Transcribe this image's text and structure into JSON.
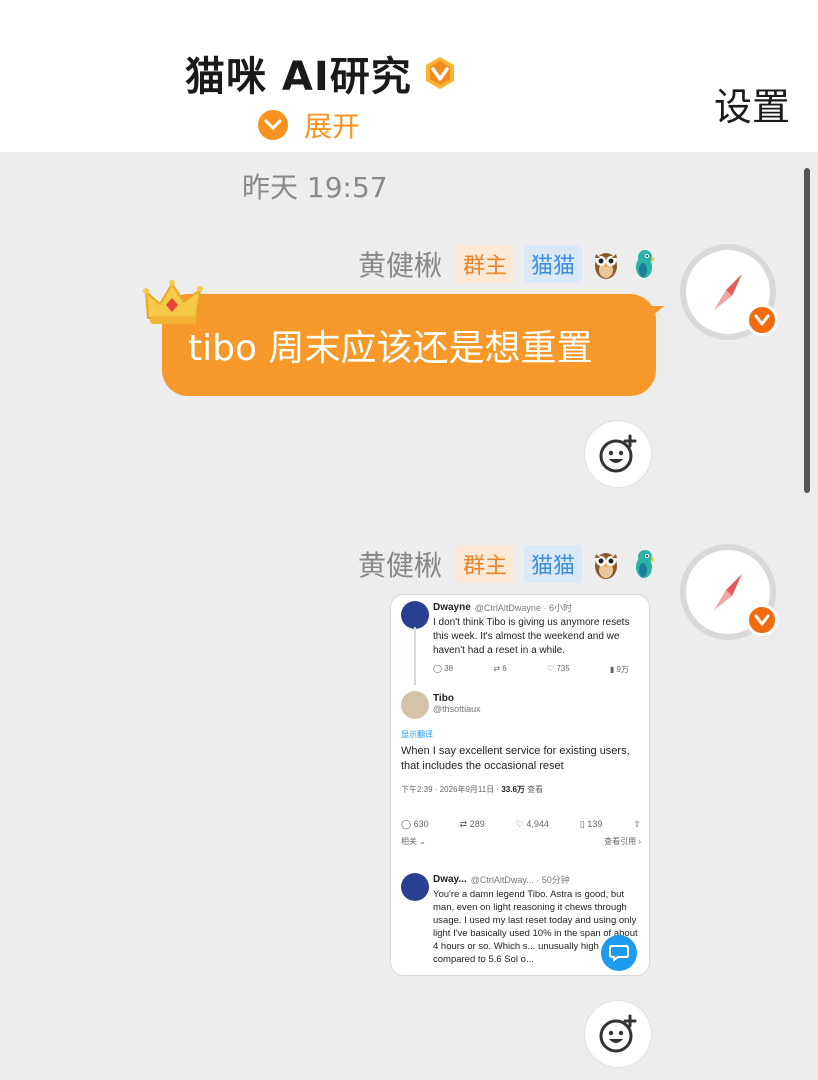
{
  "header": {
    "title": "猫咪 AI研究",
    "expand_label": "展开",
    "settings_label": "设置"
  },
  "chat": {
    "timestamp": "昨天 19:57",
    "messages": [
      {
        "sender": "黄健楸",
        "tags": [
          "群主",
          "猫猫"
        ],
        "text": "tibo 周末应该还是想重置"
      },
      {
        "sender": "黄健楸",
        "tags": [
          "群主",
          "猫猫"
        ],
        "image": {
          "tweets": [
            {
              "name": "Dwayne",
              "handle": "@CtrlAltDwayne · 6小时",
              "text": "I don't think Tibo is giving us anymore resets this week. It's almost the weekend and we haven't had a reset in a while.",
              "actions": [
                "38",
                "6",
                "735",
                "9万"
              ]
            },
            {
              "name": "Tibo",
              "handle": "@thsottiaux",
              "translate": "显示翻译",
              "text": "When I say excellent service for existing users, that includes the occasional reset",
              "meta": "下午2:39 · 2026年9月11日 · ",
              "views": "33.6万",
              "views_label": "查看",
              "actions": [
                "630",
                "289",
                "4,944",
                "139"
              ],
              "more_left": "相关 ⌄",
              "more_right": "查看引用 ›"
            },
            {
              "name": "Dway...",
              "handle": "@CtrlAltDway... · 50分钟",
              "text": "You're a damn legend Tibo. Astra is good, but man, even on light reasoning it chews through usage. I used my last reset today and using only light I've basically used 10% in the span of about 4 hours or so. Which s... unusually high compared to 5.6 Sol o..."
            }
          ]
        }
      }
    ]
  },
  "colors": {
    "accent": "#f7992a",
    "badge_orange": "#f26b0f",
    "tag_owner": "#e8832a",
    "tag_cat": "#3d8fdd"
  }
}
